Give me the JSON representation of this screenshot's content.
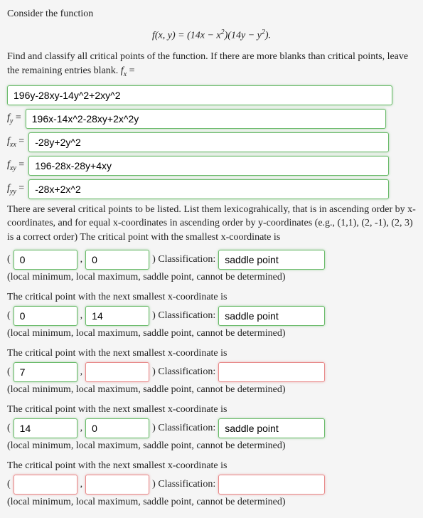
{
  "intro": "Consider the function",
  "equation": "f(x, y) = (14x − x²)(14y − y²).",
  "find_text": "Find and classify all critical points of the function. If there are more blanks than critical points, leave the remaining entries blank.",
  "fx_label_prefix": "f",
  "fx_label_sub": "x",
  "equals": " = ",
  "derivatives": {
    "fx": "196y-28xy-14y^2+2xy^2",
    "fy": "196x-14x^2-28xy+2x^2y",
    "fxx": "-28y+2y^2",
    "fxy": "196-28x-28y+4xy",
    "fyy": "-28x+2x^2"
  },
  "list_intro": "There are several critical points to be listed. List them lexicograhically, that is in ascending order by x-coordinates, and for equal x-coordinates in ascending order by y-coordinates (e.g., (1,1), (2, -1), (2, 3) is a correct order) The critical point with the smallest x-coordinate is",
  "lparen": "(",
  "comma": ",",
  "rparen_class": ") Classification:",
  "hint": "(local minimum, local maximum, saddle point, cannot be determined)",
  "next_prompt": "The critical point with the next smallest x-coordinate is",
  "points": [
    {
      "x": "0",
      "y": "0",
      "class": "saddle point",
      "sx": "correct",
      "sy": "correct",
      "sc": "correct"
    },
    {
      "x": "0",
      "y": "14",
      "class": "saddle point",
      "sx": "correct",
      "sy": "correct",
      "sc": "correct"
    },
    {
      "x": "7",
      "y": "",
      "class": "",
      "sx": "correct",
      "sy": "incorrect",
      "sc": "incorrect"
    },
    {
      "x": "14",
      "y": "0",
      "class": "saddle point",
      "sx": "correct",
      "sy": "correct",
      "sc": "correct"
    },
    {
      "x": "",
      "y": "",
      "class": "",
      "sx": "incorrect",
      "sy": "incorrect",
      "sc": "incorrect"
    }
  ]
}
